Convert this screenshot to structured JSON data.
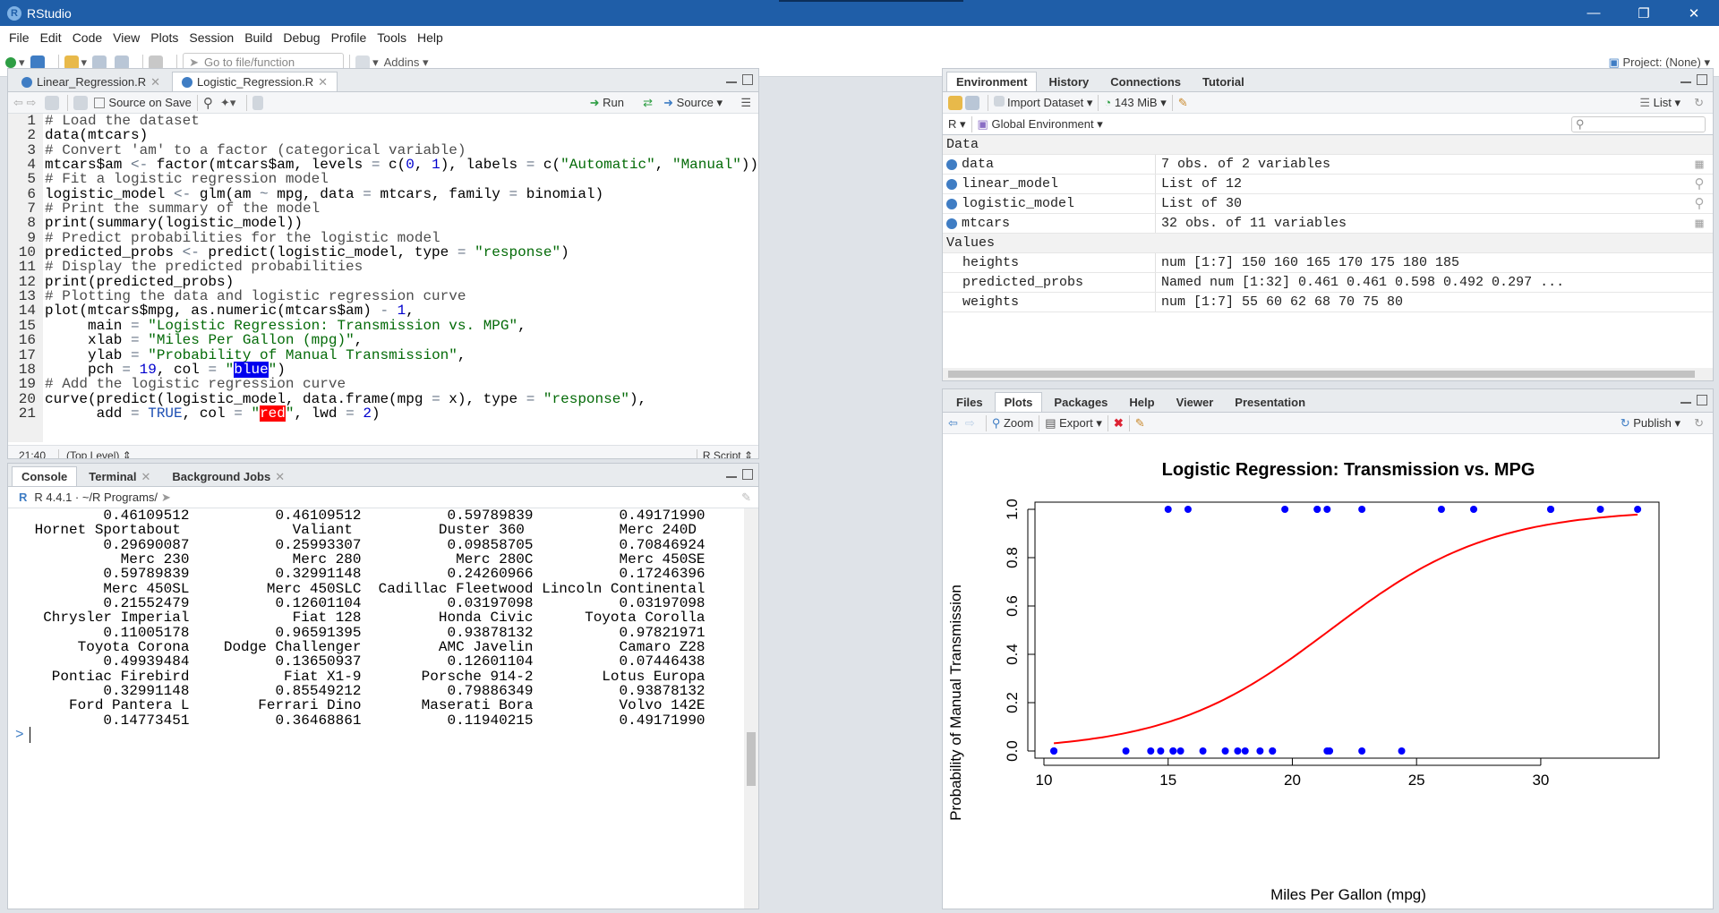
{
  "app": {
    "title": "RStudio",
    "project": "Project: (None)"
  },
  "menu": [
    "File",
    "Edit",
    "Code",
    "View",
    "Plots",
    "Session",
    "Build",
    "Debug",
    "Profile",
    "Tools",
    "Help"
  ],
  "toolbar": {
    "goto_placeholder": "Go to file/function",
    "addins": "Addins"
  },
  "editor": {
    "tabs": [
      {
        "label": "Linear_Regression.R"
      },
      {
        "label": "Logistic_Regression.R"
      }
    ],
    "source_on_save": "Source on Save",
    "run": "Run",
    "source": "Source",
    "position": "21:40",
    "scope": "(Top Level)",
    "filetype": "R Script",
    "lines": [
      "# Load the dataset",
      "data(mtcars)",
      "# Convert 'am' to a factor (categorical variable)",
      "mtcars$am <- factor(mtcars$am, levels = c(0, 1), labels = c(\"Automatic\", \"Manual\"))",
      "# Fit a logistic regression model",
      "logistic_model <- glm(am ~ mpg, data = mtcars, family = binomial)",
      "# Print the summary of the model",
      "print(summary(logistic_model))",
      "# Predict probabilities for the logistic model",
      "predicted_probs <- predict(logistic_model, type = \"response\")",
      "# Display the predicted probabilities",
      "print(predicted_probs)",
      "# Plotting the data and logistic regression curve",
      "plot(mtcars$mpg, as.numeric(mtcars$am) - 1,",
      "     main = \"Logistic Regression: Transmission vs. MPG\",",
      "     xlab = \"Miles Per Gallon (mpg)\",",
      "     ylab = \"Probability of Manual Transmission\",",
      "     pch = 19, col = \"blue\")",
      "# Add the logistic regression curve",
      "curve(predict(logistic_model, data.frame(mpg = x), type = \"response\"),",
      "      add = TRUE, col = \"red\", lwd = 2)"
    ]
  },
  "console": {
    "tabs": [
      {
        "label": "Console"
      },
      {
        "label": "Terminal"
      },
      {
        "label": "Background Jobs"
      }
    ],
    "version": "R 4.4.1 · ~/R Programs/",
    "prompt": ">",
    "output": [
      "         0.46109512          0.46109512          0.59789839          0.49171990",
      " Hornet Sportabout             Valiant          Duster 360           Merc 240D",
      "         0.29690087          0.25993307          0.09858705          0.70846924",
      "           Merc 230            Merc 280           Merc 280C          Merc 450SE",
      "         0.59789839          0.32991148          0.24260966          0.17246396",
      "         Merc 450SL         Merc 450SLC  Cadillac Fleetwood Lincoln Continental",
      "         0.21552479          0.12601104          0.03197098          0.03197098",
      "  Chrysler Imperial            Fiat 128         Honda Civic      Toyota Corolla",
      "         0.11005178          0.96591395          0.93878132          0.97821971",
      "      Toyota Corona    Dodge Challenger         AMC Javelin          Camaro Z28",
      "         0.49939484          0.13650937          0.12601104          0.07446438",
      "   Pontiac Firebird           Fiat X1-9       Porsche 914-2        Lotus Europa",
      "         0.32991148          0.85549212          0.79886349          0.93878132",
      "     Ford Pantera L        Ferrari Dino       Maserati Bora          Volvo 142E",
      "         0.14773451          0.36468861          0.11940215          0.49171990"
    ]
  },
  "environment": {
    "tabs": [
      {
        "label": "Environment"
      },
      {
        "label": "History"
      },
      {
        "label": "Connections"
      },
      {
        "label": "Tutorial"
      }
    ],
    "import": "Import Dataset",
    "memory": "143 MiB",
    "view": "List",
    "lang": "R",
    "scope": "Global Environment",
    "data_header": "Data",
    "values_header": "Values",
    "data": [
      {
        "name": "data",
        "value": "7 obs. of 2 variables"
      },
      {
        "name": "linear_model",
        "value": "List of  12"
      },
      {
        "name": "logistic_model",
        "value": "List of  30"
      },
      {
        "name": "mtcars",
        "value": "32 obs. of 11 variables"
      }
    ],
    "values": [
      {
        "name": "heights",
        "value": "num [1:7] 150 160 165 170 175 180 185"
      },
      {
        "name": "predicted_probs",
        "value": "Named num [1:32] 0.461 0.461 0.598 0.492 0.297 ..."
      },
      {
        "name": "weights",
        "value": "num [1:7] 55 60 62 68 70 75 80"
      }
    ]
  },
  "files": {
    "tabs": [
      {
        "label": "Files"
      },
      {
        "label": "Plots"
      },
      {
        "label": "Packages"
      },
      {
        "label": "Help"
      },
      {
        "label": "Viewer"
      },
      {
        "label": "Presentation"
      }
    ],
    "zoom": "Zoom",
    "export": "Export",
    "publish": "Publish"
  },
  "chart_data": {
    "type": "scatter",
    "title": "Logistic Regression: Transmission vs. MPG",
    "xlabel": "Miles Per Gallon (mpg)",
    "ylabel": "Probability of Manual Transmission",
    "xlim": [
      10,
      34
    ],
    "ylim": [
      0,
      1
    ],
    "xticks": [
      "10",
      "15",
      "20",
      "25",
      "30"
    ],
    "yticks": [
      "0.0",
      "0.2",
      "0.4",
      "0.6",
      "0.8",
      "1.0"
    ],
    "point_color": "#0000ff",
    "curve_color": "#ff0000",
    "points_manual": [
      21,
      22.8,
      32.4,
      30.4,
      33.9,
      27.3,
      26,
      30.4,
      15.8,
      19.7,
      15,
      21.4,
      21
    ],
    "points_automatic": [
      21.4,
      18.7,
      18.1,
      14.3,
      24.4,
      22.8,
      19.2,
      17.8,
      16.4,
      17.3,
      15.2,
      10.4,
      10.4,
      14.7,
      21.5,
      15.5,
      15.2,
      13.3,
      19.2
    ],
    "curve": {
      "intercept": -6.604,
      "slope": 0.307
    }
  }
}
